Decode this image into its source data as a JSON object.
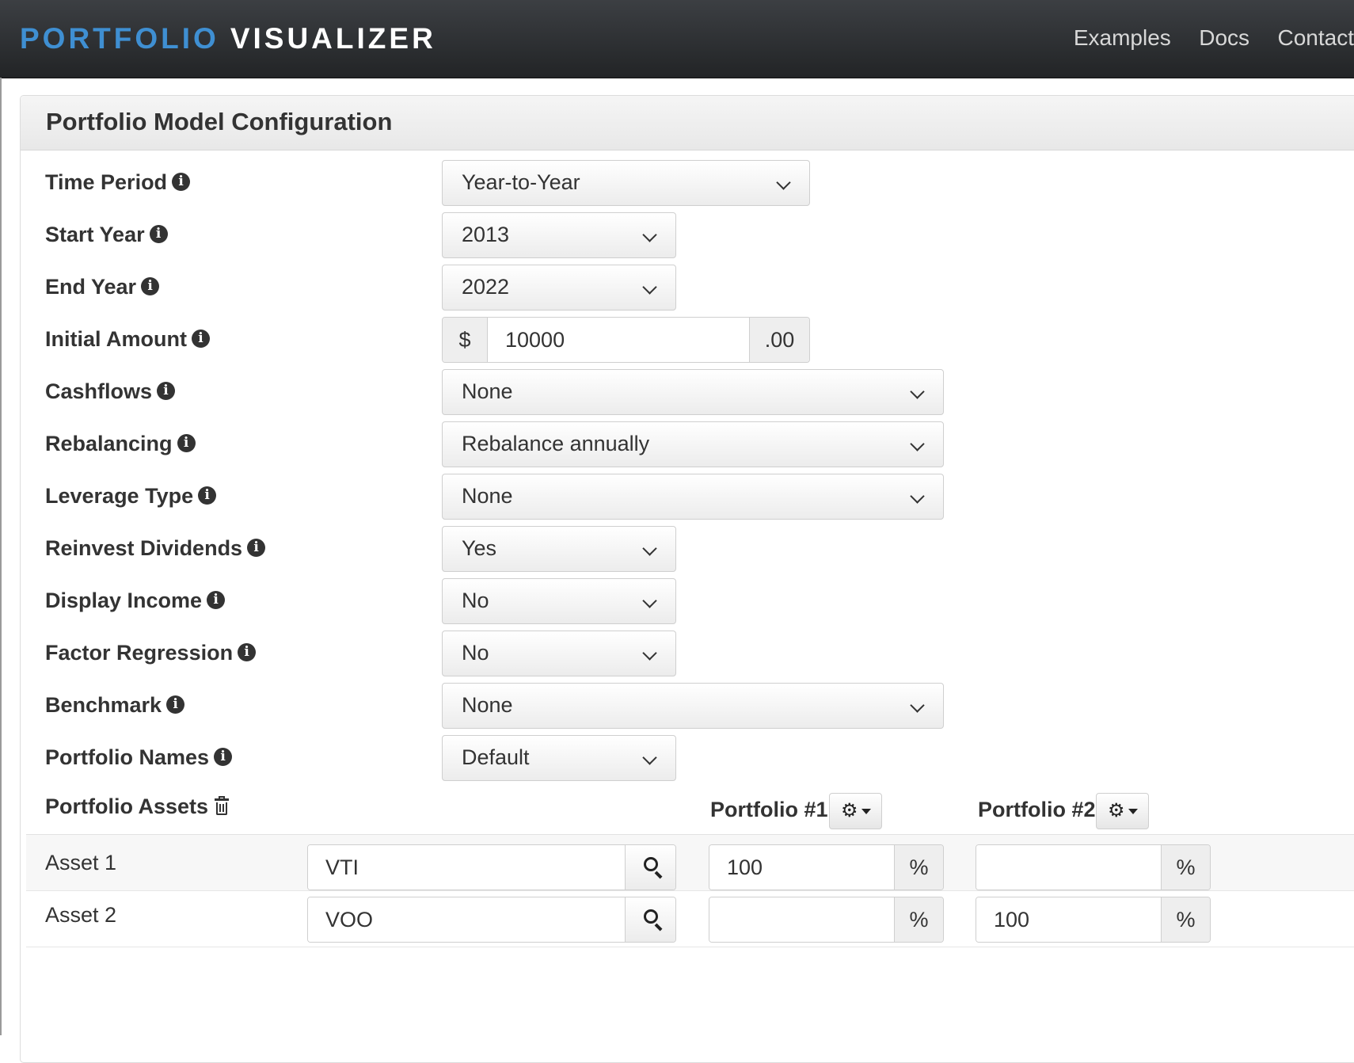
{
  "brand": {
    "part1": "PORTFOLIO",
    "part2": "VISUALIZER"
  },
  "nav": {
    "examples": "Examples",
    "docs": "Docs",
    "contact": "Contact"
  },
  "panel": {
    "title": "Portfolio Model Configuration"
  },
  "form": {
    "time_period": {
      "label": "Time Period",
      "value": "Year-to-Year"
    },
    "start_year": {
      "label": "Start Year",
      "value": "2013"
    },
    "end_year": {
      "label": "End Year",
      "value": "2022"
    },
    "initial_amount": {
      "label": "Initial Amount",
      "prefix": "$",
      "value": "10000",
      "suffix": ".00"
    },
    "cashflows": {
      "label": "Cashflows",
      "value": "None"
    },
    "rebalancing": {
      "label": "Rebalancing",
      "value": "Rebalance annually"
    },
    "leverage_type": {
      "label": "Leverage Type",
      "value": "None"
    },
    "reinvest_dividends": {
      "label": "Reinvest Dividends",
      "value": "Yes"
    },
    "display_income": {
      "label": "Display Income",
      "value": "No"
    },
    "factor_regression": {
      "label": "Factor Regression",
      "value": "No"
    },
    "benchmark": {
      "label": "Benchmark",
      "value": "None"
    },
    "portfolio_names": {
      "label": "Portfolio Names",
      "value": "Default"
    }
  },
  "assets": {
    "label": "Portfolio Assets",
    "portfolio1_label": "Portfolio #1",
    "portfolio2_label": "Portfolio #2",
    "percent_symbol": "%",
    "rows": [
      {
        "label": "Asset 1",
        "ticker": "VTI",
        "p1": "100",
        "p2": ""
      },
      {
        "label": "Asset 2",
        "ticker": "VOO",
        "p1": "",
        "p2": "100"
      }
    ]
  },
  "icons": {
    "info": "info-circle-icon",
    "trash": "trash-icon",
    "search": "search-icon",
    "gear": "gear-icon",
    "chevron": "chevron-down-icon"
  },
  "colors": {
    "navbar_bg": "#2b2d30",
    "brand_accent": "#3f8fd2",
    "brand_white": "#ffffff",
    "panel_heading_bg": "#efefef"
  }
}
